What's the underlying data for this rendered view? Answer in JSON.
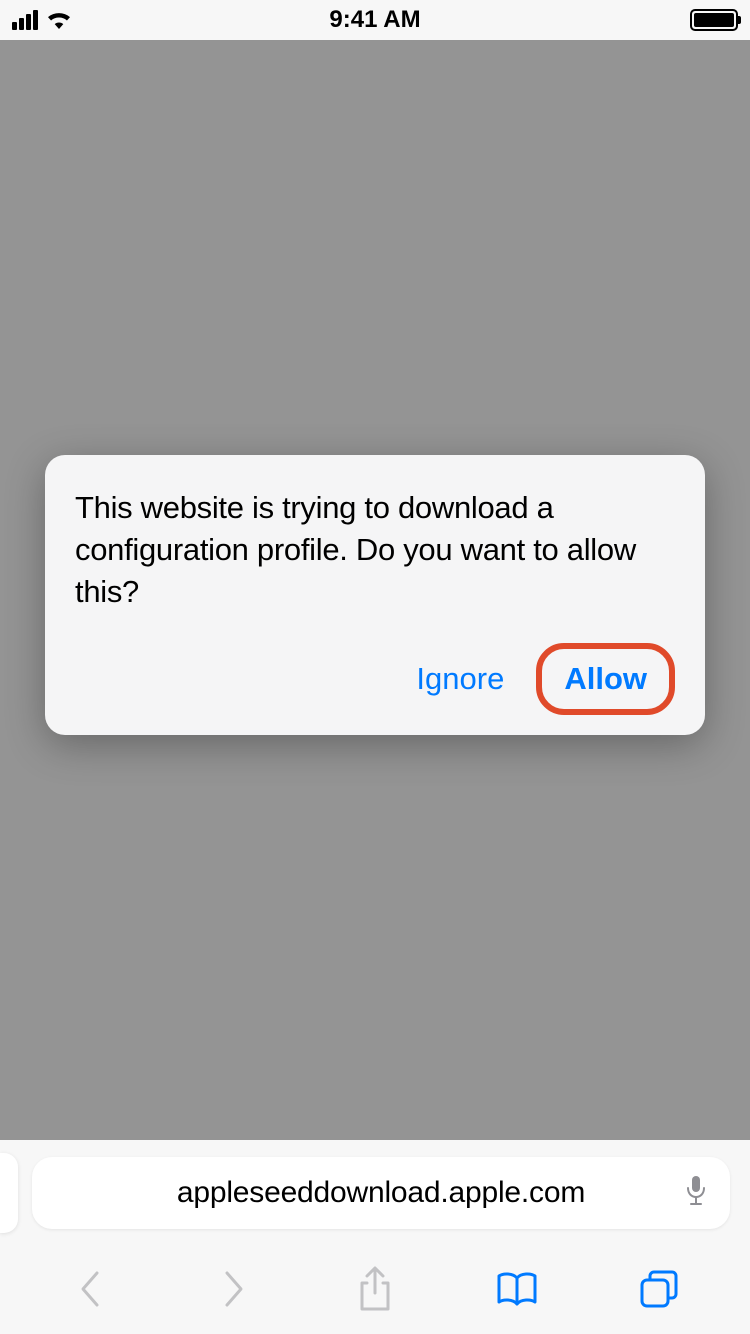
{
  "status_bar": {
    "time": "9:41 AM"
  },
  "dialog": {
    "message": "This website is trying to download a configuration profile. Do you want to allow this?",
    "ignore_label": "Ignore",
    "allow_label": "Allow"
  },
  "url_bar": {
    "url": "appleseeddownload.apple.com"
  },
  "colors": {
    "accent": "#007aff",
    "highlight": "#e04a2a"
  }
}
